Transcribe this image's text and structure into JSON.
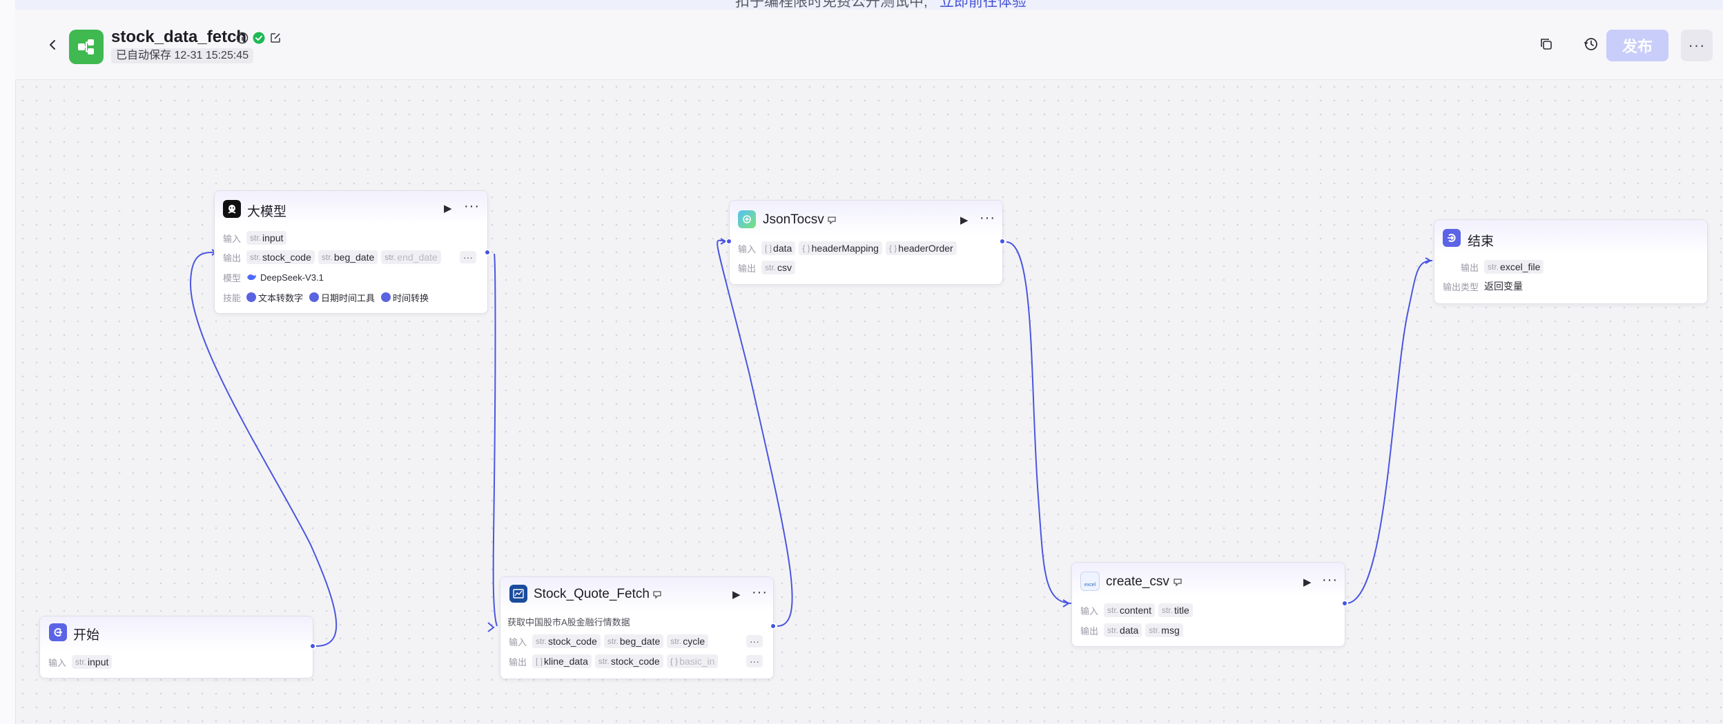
{
  "banner": {
    "text": "扣子编程限时免费公开测试中,",
    "link": "立即前往体验"
  },
  "header": {
    "title": "stock_data_fetch",
    "autosave": "已自动保存 12-31 15:25:45",
    "publish_label": "发布",
    "more_label": "···"
  },
  "colors": {
    "accent": "#4654e0",
    "app_icon": "#3fb950",
    "publish_disabled": "#c8cdfa"
  },
  "labels": {
    "input": "输入",
    "output": "输出",
    "model": "模型",
    "skills": "技能",
    "output_type": "输出类型",
    "str": "str.",
    "arr": "[ ]",
    "obj": "{ }",
    "more": "···",
    "run": "▶"
  },
  "nodes": {
    "start": {
      "title": "开始",
      "inputs": [
        "input"
      ]
    },
    "llm": {
      "title": "大模型",
      "inputs": [
        "input"
      ],
      "outputs": [
        "stock_code",
        "beg_date",
        "end_date"
      ],
      "model": "DeepSeek-V3.1",
      "skills": [
        "文本转数字",
        "日期时间工具",
        "时间转换"
      ]
    },
    "stock": {
      "title": "Stock_Quote_Fetch",
      "desc": "获取中国股市A股金融行情数据",
      "inputs": [
        "stock_code",
        "beg_date",
        "cycle"
      ],
      "outputs": [
        "kline_data",
        "stock_code",
        "basic_in"
      ]
    },
    "json": {
      "title": "JsonTocsv",
      "inputs": [
        "data",
        "headerMapping",
        "headerOrder"
      ],
      "outputs": [
        "csv"
      ]
    },
    "csv": {
      "title": "create_csv",
      "icon_text": "excel",
      "inputs": [
        "content",
        "title"
      ],
      "outputs": [
        "data",
        "msg"
      ]
    },
    "end": {
      "title": "结束",
      "outputs": [
        "excel_file"
      ],
      "output_type": "返回变量"
    }
  }
}
